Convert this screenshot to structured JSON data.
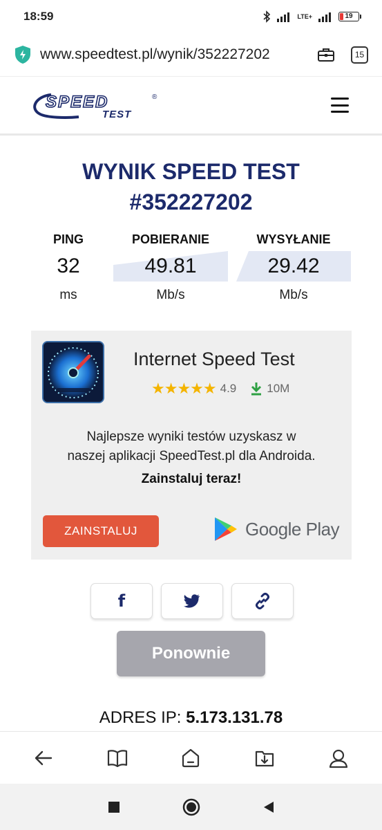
{
  "status_bar": {
    "time": "18:59",
    "network": "LTE+",
    "battery": "19"
  },
  "browser": {
    "url": "www.speedtest.pl/wynik/352227202",
    "tab_count": "15"
  },
  "site": {
    "logo_text": "SPEED",
    "logo_subtext": "TEST",
    "logo_mark": "®"
  },
  "result": {
    "title_line1": "WYNIK SPEED TEST",
    "title_line2": "#352227202"
  },
  "stats": [
    {
      "label": "PING",
      "value": "32",
      "unit": "ms"
    },
    {
      "label": "POBIERANIE",
      "value": "49.81",
      "unit": "Mb/s"
    },
    {
      "label": "WYSYŁANIE",
      "value": "29.42",
      "unit": "Mb/s"
    }
  ],
  "ad": {
    "app_name": "Internet Speed Test",
    "rating": "4.9",
    "stars": "★★★★★",
    "downloads": "10M",
    "description_line1": "Najlepsze wyniki testów uzyskasz w",
    "description_line2": "naszej aplikacji SpeedTest.pl dla Androida.",
    "cta": "Zainstaluj teraz!",
    "install_label": "ZAINSTALUJ",
    "store_label": "Google Play",
    "colors": {
      "install": "#e2573c",
      "stars": "#f4b400",
      "download": "#2ea043"
    }
  },
  "share": {
    "facebook": "f",
    "twitter": "twitter-icon",
    "link": "link-icon"
  },
  "again_label": "Ponownie",
  "ip": {
    "label": "ADRES IP:",
    "value": "5.173.131.78"
  },
  "theme": {
    "title_color": "#1c2a6b",
    "again_bg": "#a6a6ad"
  }
}
